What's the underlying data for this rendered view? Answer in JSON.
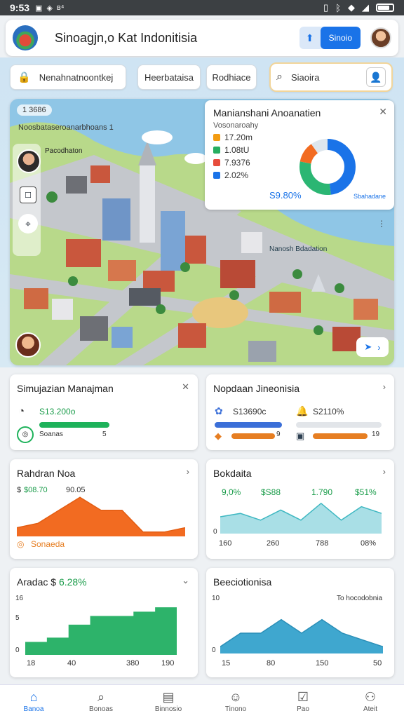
{
  "status_bar": {
    "time": "9:53",
    "icons": [
      "sim-icon",
      "notification-icon",
      "data-icon"
    ]
  },
  "app_bar": {
    "title": "Sinoagjn,o Kat Indonitisia",
    "action_label": "Sinoio"
  },
  "filters": {
    "field1": "Nenahnatnoontkej",
    "field2": "Heerbataisa",
    "field3": "Rodhiace",
    "search_value": "Siaoira"
  },
  "map": {
    "chip": "1 3686",
    "subtitle": "Noosbataseroanarbhoans 1",
    "avatar_label": "Pacodhaton",
    "place_label": "Nanosh Bdadation"
  },
  "stats_card": {
    "title": "Manianshani Anoanatien",
    "subtitle": "Vosonaroahy",
    "rows": [
      {
        "icon": "coin-icon",
        "value": "17.20m",
        "color": "#f39c12"
      },
      {
        "icon": "chart-icon",
        "value": "1.08tU",
        "color": "#27ae60"
      },
      {
        "icon": "tag-icon",
        "value": "7.9376",
        "color": "#e74c3c"
      },
      {
        "icon": "doc-icon",
        "value": "2.02%",
        "color": "#1a73e8"
      }
    ],
    "total": "S9.80%",
    "pie_label": "Sbahadane"
  },
  "card_resources": {
    "title": "Simujazian Manajman",
    "row1_value": "S13.200o",
    "row2_label": "Soanas",
    "row2_value": "5",
    "icon1": "gauge-icon",
    "icon2": "badge-icon",
    "bar_color": "#1db25a"
  },
  "card_regions": {
    "title": "Nopdaan Jineonisia",
    "left_value": "S13690c",
    "right_value": "S2110%",
    "row2_left": "9",
    "row2_right": "19",
    "bar_colors": [
      "#3b6fd8",
      "#e67e22"
    ]
  },
  "card_orange": {
    "title": "Rahdran Noa",
    "v1": "$08.70",
    "v2": "90.05",
    "legend": "Sonaeda"
  },
  "card_teal": {
    "title": "Bokdaita",
    "v1": "9,0%",
    "v2": "$S88",
    "v3": "1.790",
    "v4": "$51%",
    "y0": "0",
    "x1": "160",
    "x2": "260",
    "x3": "788",
    "x4": "08%"
  },
  "card_green": {
    "title": "Aradac $",
    "title_value": "6.28%",
    "y_top": "16",
    "y_mid": "5",
    "y0": "0",
    "x1": "18",
    "x2": "40",
    "x3": "380",
    "x4": "190"
  },
  "card_blue": {
    "title": "Beeciotionisa",
    "y_top": "10",
    "corner": "To hocodobnia",
    "y0": "0",
    "x1": "15",
    "x2": "80",
    "x3": "150",
    "x4": "50"
  },
  "chart_data": [
    {
      "type": "pie",
      "title": "Manianshani Anoanatien",
      "values": [
        48,
        30,
        12,
        10
      ],
      "colors": [
        "#1a73e8",
        "#2bb673",
        "#f26b21",
        "#dde6ee"
      ]
    },
    {
      "type": "area",
      "title": "Rahdran Noa",
      "values": [
        2,
        3,
        6,
        9,
        6,
        6,
        1,
        1,
        2
      ]
    },
    {
      "type": "area",
      "title": "Bokdaita",
      "values": [
        5,
        6,
        4,
        7,
        4,
        9,
        4,
        8,
        6
      ]
    },
    {
      "type": "area",
      "title": "Aradac $",
      "values": [
        3,
        4,
        7,
        9,
        9,
        10,
        11,
        11
      ]
    },
    {
      "type": "area",
      "title": "Beeciotionisa",
      "values": [
        1,
        3,
        3,
        5,
        3,
        5,
        3,
        2,
        1
      ]
    }
  ],
  "nav": [
    {
      "label": "Banoa",
      "icon": "home-icon",
      "active": true
    },
    {
      "label": "Bonoas",
      "icon": "search-icon"
    },
    {
      "label": "Binnosio",
      "icon": "clipboard-icon"
    },
    {
      "label": "Tinono",
      "icon": "person-icon"
    },
    {
      "label": "Pao",
      "icon": "check-icon"
    },
    {
      "label": "Ateit",
      "icon": "account-icon"
    }
  ]
}
